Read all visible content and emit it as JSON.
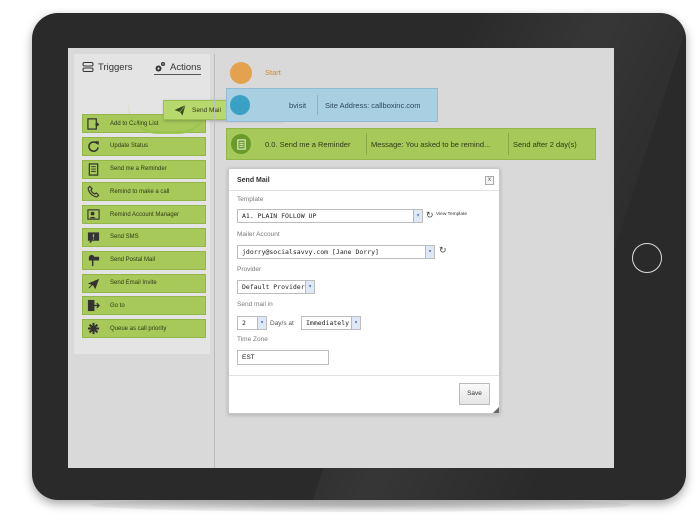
{
  "left_panel": {
    "tabs": {
      "triggers": "Triggers",
      "actions": "Actions"
    },
    "dragged_item": "Send Mail",
    "actions": [
      {
        "label": "Add to Calling List",
        "icon": "add-list-icon"
      },
      {
        "label": "Update Status",
        "icon": "refresh-icon"
      },
      {
        "label": "Send me a Reminder",
        "icon": "reminder-icon"
      },
      {
        "label": "Remind to make a call",
        "icon": "phone-icon"
      },
      {
        "label": "Remind Account Manager",
        "icon": "manager-icon"
      },
      {
        "label": "Send SMS",
        "icon": "sms-icon"
      },
      {
        "label": "Send Postal Mail",
        "icon": "mailbox-icon"
      },
      {
        "label": "Send Email Invite",
        "icon": "email-invite-icon"
      },
      {
        "label": "Go to",
        "icon": "goto-icon"
      },
      {
        "label": "Queue as call priority",
        "icon": "priority-icon"
      }
    ]
  },
  "workflow": {
    "start_label": "Start",
    "trigger_node": {
      "label": "bvisit",
      "site": "Site Address: callboxinc.com"
    },
    "reminder_node": {
      "title": "0.0. Send me a Reminder",
      "message": "Message: You asked to be remind...",
      "timing": "Send after 2 day(s)"
    }
  },
  "modal": {
    "title": "Send Mail",
    "close": "x",
    "template_label": "Template",
    "template_value": "A1. PLAIN FOLLOW UP",
    "view_template": "View Template",
    "mailer_label": "Mailer Account",
    "mailer_value": "jdorry@socialsavvy.com [Jane Dorry]",
    "provider_label": "Provider",
    "provider_value": "Default Provider",
    "send_in_label": "Send mail in",
    "days_value": "2",
    "days_at": "Day/s at",
    "at_value": "Immediately",
    "timezone_label": "Time Zone",
    "timezone_value": "EST",
    "save": "Save"
  },
  "colors": {
    "action_green": "#a6c95a",
    "trigger_blue": "#a9cfe3",
    "start_orange": "#e4a24e",
    "frame": "#2a2a2a"
  }
}
